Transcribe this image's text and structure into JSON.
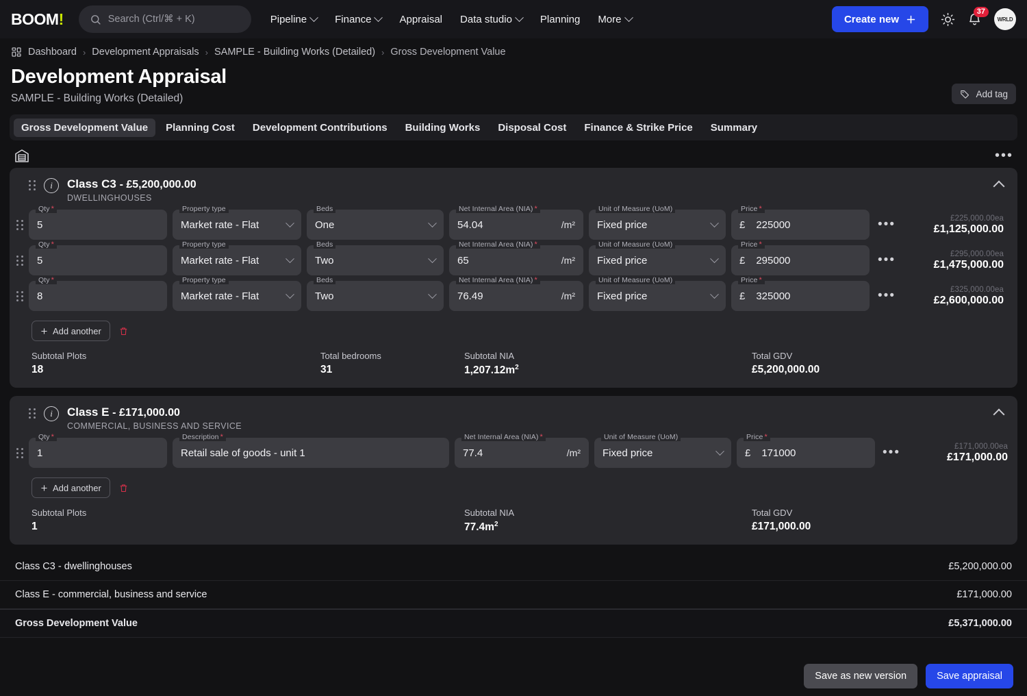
{
  "topbar": {
    "logo": "BOOM",
    "logo_bang": "!",
    "search_placeholder": "Search (Ctrl/⌘ + K)",
    "nav": [
      {
        "label": "Pipeline",
        "caret": true
      },
      {
        "label": "Finance",
        "caret": true
      },
      {
        "label": "Appraisal",
        "caret": false
      },
      {
        "label": "Data studio",
        "caret": true
      },
      {
        "label": "Planning",
        "caret": false
      },
      {
        "label": "More",
        "caret": true
      }
    ],
    "create_label": "Create new",
    "notification_count": "37",
    "avatar_initials": "WRLD"
  },
  "breadcrumb": [
    "Dashboard",
    "Development Appraisals",
    "SAMPLE - Building Works (Detailed)",
    "Gross Development Value"
  ],
  "header": {
    "title": "Development Appraisal",
    "subtitle": "SAMPLE - Building Works (Detailed)",
    "add_tag_label": "Add tag"
  },
  "tabs": [
    {
      "label": "Gross Development Value",
      "active": true
    },
    {
      "label": "Planning Cost",
      "active": false
    },
    {
      "label": "Development Contributions",
      "active": false
    },
    {
      "label": "Building Works",
      "active": false
    },
    {
      "label": "Disposal Cost",
      "active": false
    },
    {
      "label": "Finance & Strike Price",
      "active": false
    },
    {
      "label": "Summary",
      "active": false
    }
  ],
  "labels": {
    "qty": "Qty",
    "property_type": "Property type",
    "beds": "Beds",
    "nia": "Net Internal Area (NIA)",
    "uom": "Unit of Measure (UoM)",
    "price": "Price",
    "description": "Description",
    "nia_suffix": "/m²",
    "currency": "£",
    "add_another": "Add another",
    "subtotal_plots": "Subtotal Plots",
    "total_bedrooms": "Total bedrooms",
    "subtotal_nia": "Subtotal NIA",
    "total_gdv": "Total GDV",
    "required_mark": "*",
    "dots": "•••"
  },
  "class_c3": {
    "title": "Class C3",
    "amount": "- £5,200,000.00",
    "subtitle": "DWELLINGHOUSES",
    "rows": [
      {
        "qty": "5",
        "property_type": "Market rate - Flat",
        "beds": "One",
        "nia": "54.04",
        "uom": "Fixed price",
        "price": "225000",
        "each": "£225,000.00ea",
        "total": "£1,125,000.00"
      },
      {
        "qty": "5",
        "property_type": "Market rate - Flat",
        "beds": "Two",
        "nia": "65",
        "uom": "Fixed price",
        "price": "295000",
        "each": "£295,000.00ea",
        "total": "£1,475,000.00"
      },
      {
        "qty": "8",
        "property_type": "Market rate - Flat",
        "beds": "Two",
        "nia": "76.49",
        "uom": "Fixed price",
        "price": "325000",
        "each": "£325,000.00ea",
        "total": "£2,600,000.00"
      }
    ],
    "subtotal_plots": "18",
    "total_bedrooms": "31",
    "subtotal_nia": "1,207.12m",
    "nia_sup": "2",
    "total_gdv": "£5,200,000.00"
  },
  "class_e": {
    "title": "Class E",
    "amount": "- £171,000.00",
    "subtitle": "COMMERCIAL, BUSINESS AND SERVICE",
    "rows": [
      {
        "qty": "1",
        "description": "Retail sale of goods - unit 1",
        "nia": "77.4",
        "uom": "Fixed price",
        "price": "171000",
        "each": "£171,000.00ea",
        "total": "£171,000.00"
      }
    ],
    "subtotal_plots": "1",
    "subtotal_nia": "77.4m",
    "nia_sup": "2",
    "total_gdv": "£171,000.00"
  },
  "summary": [
    {
      "label": "Class C3 - dwellinghouses",
      "value": "£5,200,000.00",
      "grand": false
    },
    {
      "label": "Class E - commercial, business and service",
      "value": "£171,000.00",
      "grand": false
    },
    {
      "label": "Gross Development Value",
      "value": "£5,371,000.00",
      "grand": true
    }
  ],
  "footer": {
    "save_version_label": "Save as new version",
    "save_label": "Save appraisal"
  },
  "colors": {
    "accent": "#2647e8",
    "badge": "#e0203a",
    "required": "#e04a5e",
    "logo_accent": "#c8e600",
    "card": "#28282c",
    "field": "#3c3c41",
    "page_bg": "#121214"
  }
}
